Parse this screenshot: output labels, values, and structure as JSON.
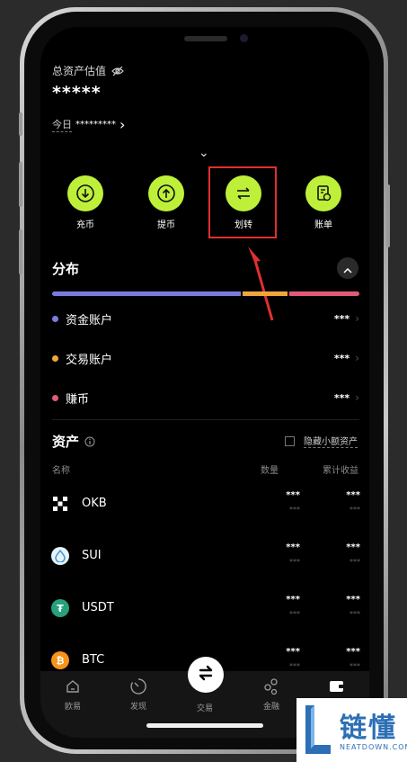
{
  "header": {
    "total_label": "总资产估值",
    "total_value": "*****",
    "today_label": "今日",
    "today_value": "*********",
    "today_arrow": "›",
    "collapse": "⌄"
  },
  "actions": [
    {
      "label": "充币",
      "icon": "deposit-icon"
    },
    {
      "label": "提币",
      "icon": "withdraw-icon"
    },
    {
      "label": "划转",
      "icon": "transfer-icon"
    },
    {
      "label": "账单",
      "icon": "bill-icon"
    }
  ],
  "distribution": {
    "title": "分布",
    "segments": [
      {
        "fraction": 0.62,
        "color": "#7b7bdf"
      },
      {
        "fraction": 0.15,
        "color": "#f0a73a"
      },
      {
        "fraction": 0.23,
        "color": "#e25a78"
      }
    ],
    "rows": [
      {
        "name": "资金账户",
        "value": "***",
        "color": "#7b7bdf"
      },
      {
        "name": "交易账户",
        "value": "***",
        "color": "#f0a73a"
      },
      {
        "name": "赚币",
        "value": "***",
        "color": "#e25a78"
      }
    ]
  },
  "assets": {
    "title": "资产",
    "hide_small": "隐藏小额资产",
    "col_name": "名称",
    "col_qty": "数量",
    "col_earn": "累计收益",
    "rows": [
      {
        "name": "OKB",
        "qty": "***",
        "qty_sub": "***",
        "earn": "***",
        "earn_sub": "***",
        "icon": "okb-icon",
        "color": "#ffffff",
        "glyph": "✕"
      },
      {
        "name": "SUI",
        "qty": "***",
        "qty_sub": "***",
        "earn": "***",
        "earn_sub": "***",
        "icon": "sui-icon",
        "color": "#dff0f8",
        "glyph": "💧"
      },
      {
        "name": "USDT",
        "qty": "***",
        "qty_sub": "***",
        "earn": "***",
        "earn_sub": "***",
        "icon": "usdt-icon",
        "color": "#26a17b",
        "glyph": "₮"
      },
      {
        "name": "BTC",
        "qty": "***",
        "qty_sub": "***",
        "earn": "***",
        "earn_sub": "***",
        "icon": "btc-icon",
        "color": "#f7931a",
        "glyph": "₿"
      }
    ]
  },
  "tabbar": [
    {
      "label": "欧易",
      "icon": "home-icon"
    },
    {
      "label": "发现",
      "icon": "discover-icon"
    },
    {
      "label": "交易",
      "icon": "trade-icon"
    },
    {
      "label": "金融",
      "icon": "finance-icon"
    },
    {
      "label": "",
      "icon": "wallet-icon"
    }
  ],
  "watermark": {
    "brand": "链懂",
    "domain": "NEATDOWN.COM"
  }
}
